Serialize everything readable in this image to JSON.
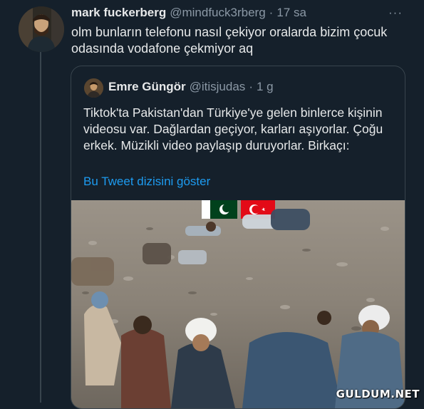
{
  "tweet": {
    "author_name": "mark fuckerberg",
    "handle": "@mindfuck3rberg",
    "separator": "·",
    "time": "17 sa",
    "more": "···",
    "text": "olm bunların telefonu nasıl çekiyor oralarda bizim çocuk odasında vodafone çekmiyor aq"
  },
  "quoted": {
    "author_name": "Emre Güngör",
    "handle": "@itisjudas",
    "separator": "·",
    "time": "1 g",
    "text": "Tiktok'ta Pakistan'dan Türkiye'ye gelen binlerce kişinin videosu var. Dağlardan geçiyor, karları aşıyorlar. Çoğu erkek. Müzikli video paylaşıp duruyorlar. Birkaçı:",
    "thread_link": "Bu Tweet dizisini göster"
  },
  "watermark": "GULDUM.NET",
  "colors": {
    "background": "#15202b",
    "link": "#1d9bf0",
    "muted": "#8b98a5",
    "border": "#38444d"
  }
}
